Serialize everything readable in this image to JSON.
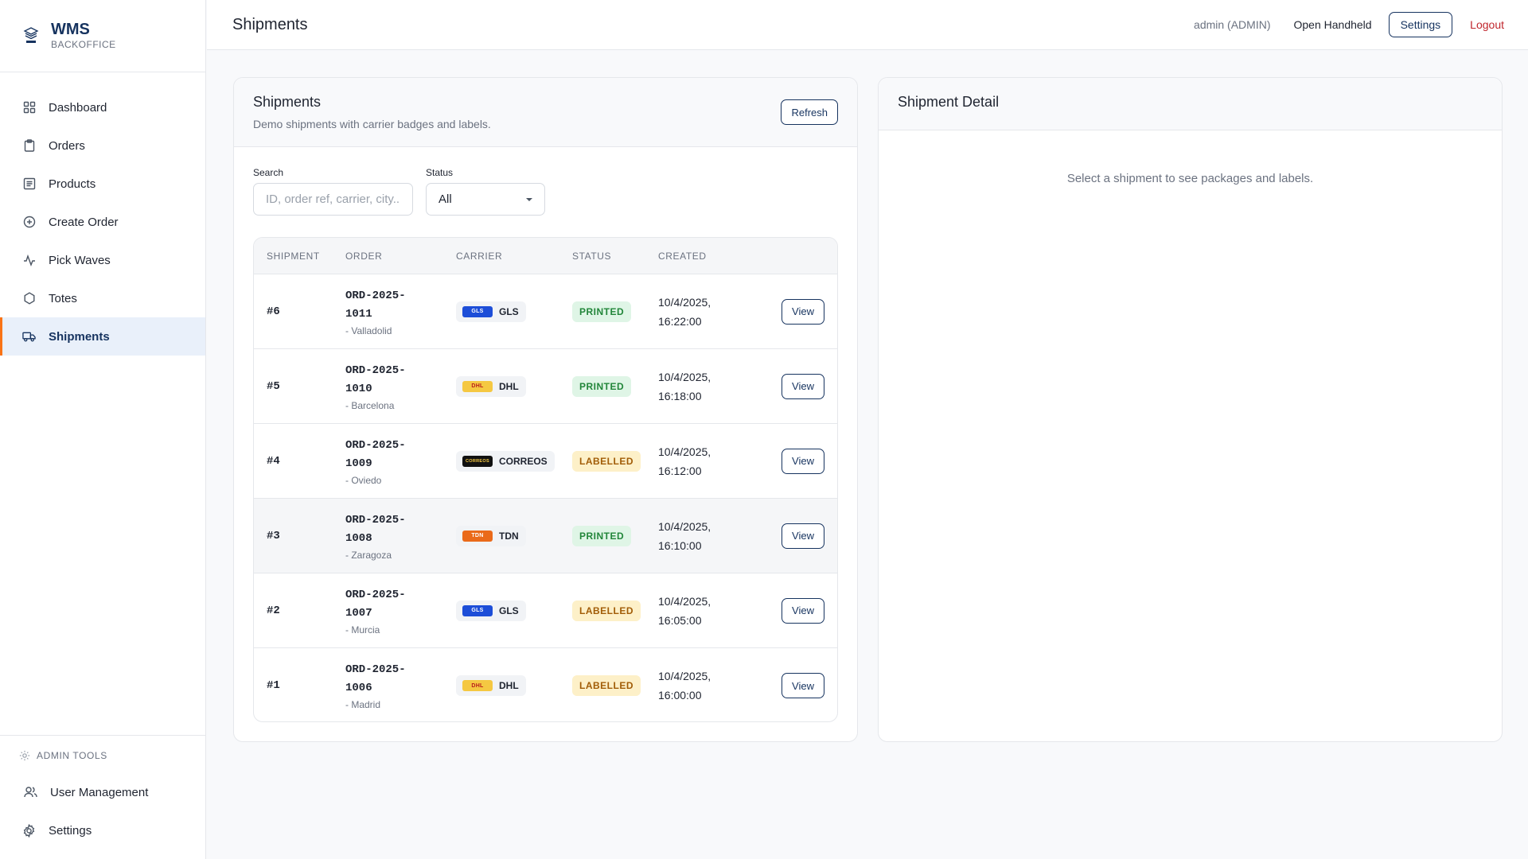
{
  "brand": {
    "title": "WMS",
    "subtitle": "BACKOFFICE",
    "logo_icon": "warehouse-logo-icon"
  },
  "sidebar": {
    "items": [
      {
        "label": "Dashboard",
        "icon": "grid-icon"
      },
      {
        "label": "Orders",
        "icon": "clipboard-icon"
      },
      {
        "label": "Products",
        "icon": "list-icon"
      },
      {
        "label": "Create Order",
        "icon": "plus-circle-icon"
      },
      {
        "label": "Pick Waves",
        "icon": "activity-icon"
      },
      {
        "label": "Totes",
        "icon": "hexagon-icon"
      },
      {
        "label": "Shipments",
        "icon": "truck-icon",
        "active": true
      }
    ],
    "admin": {
      "label": "ADMIN TOOLS",
      "items": [
        {
          "label": "User Management",
          "icon": "users-icon"
        },
        {
          "label": "Settings",
          "icon": "gear-icon"
        }
      ]
    }
  },
  "topbar": {
    "title": "Shipments",
    "user": "admin (ADMIN)",
    "handheld": "Open Handheld",
    "settings": "Settings",
    "logout": "Logout"
  },
  "list": {
    "title": "Shipments",
    "subtitle": "Demo shipments with carrier badges and labels.",
    "refresh": "Refresh",
    "search_label": "Search",
    "search_placeholder": "ID, order ref, carrier, city...",
    "status_label": "Status",
    "status_value": "All",
    "columns": [
      "SHIPMENT",
      "ORDER",
      "CARRIER",
      "STATUS",
      "CREATED"
    ],
    "view_label": "View",
    "rows": [
      {
        "id": "#6",
        "order_line1": "ORD-2025-",
        "order_line2": "1011",
        "city": "- Valladolid",
        "carrier": "GLS",
        "logo_text": "GLS",
        "status": "PRINTED",
        "created_date": "10/4/2025,",
        "created_time": "16:22:00"
      },
      {
        "id": "#5",
        "order_line1": "ORD-2025-",
        "order_line2": "1010",
        "city": "- Barcelona",
        "carrier": "DHL",
        "logo_text": "DHL",
        "status": "PRINTED",
        "created_date": "10/4/2025,",
        "created_time": "16:18:00"
      },
      {
        "id": "#4",
        "order_line1": "ORD-2025-",
        "order_line2": "1009",
        "city": "- Oviedo",
        "carrier": "CORREOS",
        "logo_text": "CORREOS",
        "status": "LABELLED",
        "created_date": "10/4/2025,",
        "created_time": "16:12:00"
      },
      {
        "id": "#3",
        "order_line1": "ORD-2025-",
        "order_line2": "1008",
        "city": "- Zaragoza",
        "carrier": "TDN",
        "logo_text": "TDN",
        "status": "PRINTED",
        "created_date": "10/4/2025,",
        "created_time": "16:10:00"
      },
      {
        "id": "#2",
        "order_line1": "ORD-2025-",
        "order_line2": "1007",
        "city": "- Murcia",
        "carrier": "GLS",
        "logo_text": "GLS",
        "status": "LABELLED",
        "created_date": "10/4/2025,",
        "created_time": "16:05:00"
      },
      {
        "id": "#1",
        "order_line1": "ORD-2025-",
        "order_line2": "1006",
        "city": "- Madrid",
        "carrier": "DHL",
        "logo_text": "DHL",
        "status": "LABELLED",
        "created_date": "10/4/2025,",
        "created_time": "16:00:00"
      }
    ]
  },
  "detail": {
    "title": "Shipment Detail",
    "empty": "Select a shipment to see packages and labels."
  },
  "colors": {
    "brand": "#16335f",
    "accent": "#f97316",
    "logout": "#c0262d",
    "gls": "#1d4ed8",
    "dhl": "#f5c842",
    "correos": "#111111",
    "tdn": "#ea6a1a",
    "printed_bg": "#dff5e6",
    "labelled_bg": "#fdf0c8"
  }
}
